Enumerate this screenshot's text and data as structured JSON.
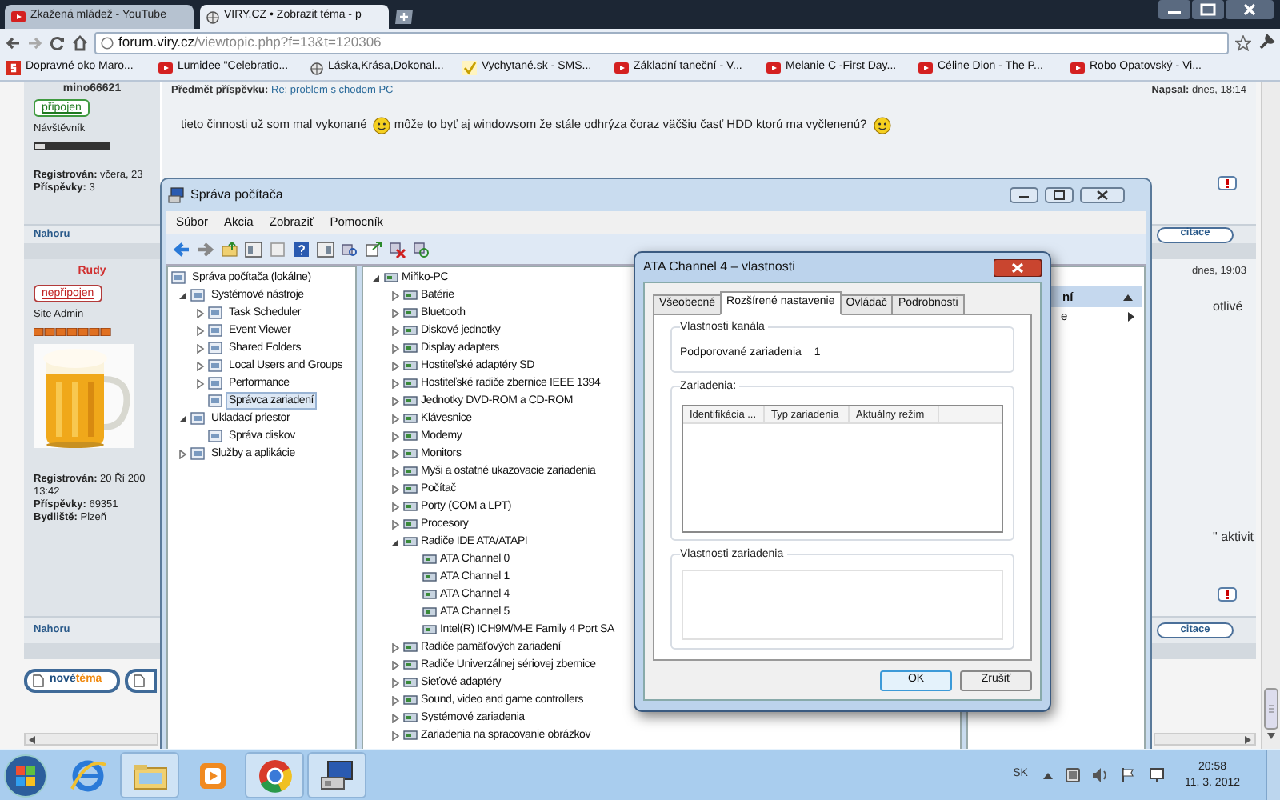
{
  "browser": {
    "tabs": [
      {
        "label": "Zkažená mládež - YouTube",
        "selected": false,
        "kind": "video"
      },
      {
        "label": "VIRY.CZ • Zobrazit téma - p",
        "selected": true,
        "kind": "globe"
      }
    ],
    "address": {
      "host": "forum.viry.cz",
      "path": "/viewtopic.php?f=13&t=120306"
    },
    "bookmarks": [
      {
        "label": "Dopravné oko Maro...",
        "kind": "site"
      },
      {
        "label": "Lumidee \"Celebratio...",
        "kind": "video"
      },
      {
        "label": "Láska,Krása,Dokonal...",
        "kind": "globe"
      },
      {
        "label": "Vychytané.sk - SMS...",
        "kind": "check"
      },
      {
        "label": "Základní taneční - V...",
        "kind": "video"
      },
      {
        "label": "Melanie C -First Day...",
        "kind": "video"
      },
      {
        "label": "Céline Dion - The P...",
        "kind": "video"
      },
      {
        "label": "Robo Opatovský - Vi...",
        "kind": "video"
      }
    ]
  },
  "forum": {
    "posts": [
      {
        "kind": "user",
        "author": "mino66621",
        "subject_label": "Předmět příspěvku:",
        "subject": "Re: problem s chodom PC",
        "posted_label": "Napsal:",
        "posted": "dnes, 18:14",
        "status": "připojen",
        "online": true,
        "rank": "Návštěvník",
        "info": [
          {
            "label": "Registrován:",
            "value": "včera, 23"
          },
          {
            "label": "Příspěvky:",
            "value": "3"
          }
        ],
        "body": [
          {
            "kind": "text",
            "text": "tieto činnosti už som mal vykonané"
          },
          {
            "kind": "smiley"
          },
          {
            "kind": "text",
            "text": "môže to byť aj windowsom že stále odhrýza čoraz väčšiu časť HDD ktorú ma vyčlenenú?"
          },
          {
            "kind": "smiley"
          }
        ],
        "top_link": "Nahoru",
        "quote": "citace"
      },
      {
        "kind": "admin",
        "author": "Rudy",
        "posted": "dnes, 19:03",
        "status": "nepřipojen",
        "online": false,
        "rank": "Site Admin",
        "avatar": {
          "kind": "picture"
        },
        "info": [
          {
            "label": "Registrován:",
            "value": "20 Ří 200"
          },
          {
            "value": "13:42"
          },
          {
            "label": "Příspěvky:",
            "value": "69351"
          },
          {
            "label": "Bydliště:",
            "value": "Plzeň"
          }
        ],
        "body": [
          {
            "kind": "fragment",
            "text": "otlivé"
          },
          {
            "kind": "fragment",
            "text": "\" aktivit"
          }
        ],
        "top_link": "Nahoru",
        "quote": "citace"
      }
    ],
    "new_topic": [
      "nové",
      "téma"
    ]
  },
  "computer_management": {
    "title": "Správa počítača",
    "menu": [
      "Súbor",
      "Akcia",
      "Zobraziť",
      "Pomocník"
    ],
    "tree": [
      {
        "label": "Správa počítača (lokálne)",
        "selected": false,
        "children": [
          {
            "label": "Systémové nástroje",
            "expanded": true,
            "selected": false,
            "children": [
              {
                "label": "Task Scheduler",
                "expanded": false,
                "selected": false
              },
              {
                "label": "Event Viewer",
                "expanded": false,
                "selected": false
              },
              {
                "label": "Shared Folders",
                "expanded": false,
                "selected": false
              },
              {
                "label": "Local Users and Groups",
                "expanded": false,
                "selected": false
              },
              {
                "label": "Performance",
                "expanded": false,
                "selected": false
              },
              {
                "label": "Správca zariadení",
                "selected": true
              }
            ]
          },
          {
            "label": "Ukladací priestor",
            "expanded": true,
            "selected": false,
            "children": [
              {
                "label": "Správa diskov",
                "selected": false
              }
            ]
          },
          {
            "label": "Služby a aplikácie",
            "expanded": false,
            "selected": false
          }
        ]
      }
    ],
    "devices": [
      {
        "label": "Miňko-PC",
        "expanded": true,
        "children": [
          {
            "label": "Batérie",
            "expanded": false
          },
          {
            "label": "Bluetooth",
            "expanded": false
          },
          {
            "label": "Diskové jednotky",
            "expanded": false
          },
          {
            "label": "Display adapters",
            "expanded": false
          },
          {
            "label": "Hostiteľské adaptéry SD",
            "expanded": false
          },
          {
            "label": "Hostiteľské radiče zbernice IEEE 1394",
            "expanded": false
          },
          {
            "label": "Jednotky DVD-ROM a CD-ROM",
            "expanded": false
          },
          {
            "label": "Klávesnice",
            "expanded": false
          },
          {
            "label": "Modemy",
            "expanded": false
          },
          {
            "label": "Monitors",
            "expanded": false
          },
          {
            "label": "Myši a ostatné ukazovacie zariadenia",
            "expanded": false
          },
          {
            "label": "Počítač",
            "expanded": false
          },
          {
            "label": "Porty (COM a LPT)",
            "expanded": false
          },
          {
            "label": "Procesory",
            "expanded": false
          },
          {
            "label": "Radiče IDE ATA/ATAPI",
            "expanded": true,
            "children": [
              {
                "label": "ATA Channel 0"
              },
              {
                "label": "ATA Channel 1"
              },
              {
                "label": "ATA Channel 4"
              },
              {
                "label": "ATA Channel 5"
              },
              {
                "label": "Intel(R) ICH9M/M-E Family 4 Port SA"
              }
            ]
          },
          {
            "label": "Radiče pamäťových zariadení",
            "expanded": false
          },
          {
            "label": "Radiče Univerzálnej sériovej zbernice",
            "expanded": false
          },
          {
            "label": "Sieťové adaptéry",
            "expanded": false
          },
          {
            "label": "Sound, video and game controllers",
            "expanded": false
          },
          {
            "label": "Systémové zariadenia",
            "expanded": false
          },
          {
            "label": "Zariadenia na spracovanie obrázkov",
            "expanded": false
          }
        ]
      }
    ],
    "action_pane": {
      "header": "ní",
      "item": "e"
    }
  },
  "dialog": {
    "title": "ATA Channel 4 – vlastnosti",
    "tabs": [
      {
        "label": "Všeobecné",
        "selected": false
      },
      {
        "label": "Rozšírené nastavenie",
        "selected": true
      },
      {
        "label": "Ovládač",
        "selected": false
      },
      {
        "label": "Podrobnosti",
        "selected": false
      }
    ],
    "channel_group": "Vlastnosti kanála",
    "supported_label": "Podporované zariadenia",
    "supported_value": "1",
    "devices_group": "Zariadenia:",
    "columns": [
      "Identifikácia ...",
      "Typ zariadenia",
      "Aktuálny režim"
    ],
    "device_props_group": "Vlastnosti zariadenia",
    "buttons": [
      {
        "label": "OK",
        "default": true
      },
      {
        "label": "Zrušiť",
        "default": false
      }
    ]
  },
  "taskbar": {
    "apps": [
      {
        "kind": "ie",
        "running": false
      },
      {
        "kind": "explorer",
        "running": true
      },
      {
        "kind": "media",
        "running": false
      },
      {
        "kind": "chrome",
        "running": true
      },
      {
        "kind": "mgmt",
        "running": true
      }
    ],
    "language": "SK",
    "time": "20:58",
    "date": "11. 3. 2012"
  }
}
